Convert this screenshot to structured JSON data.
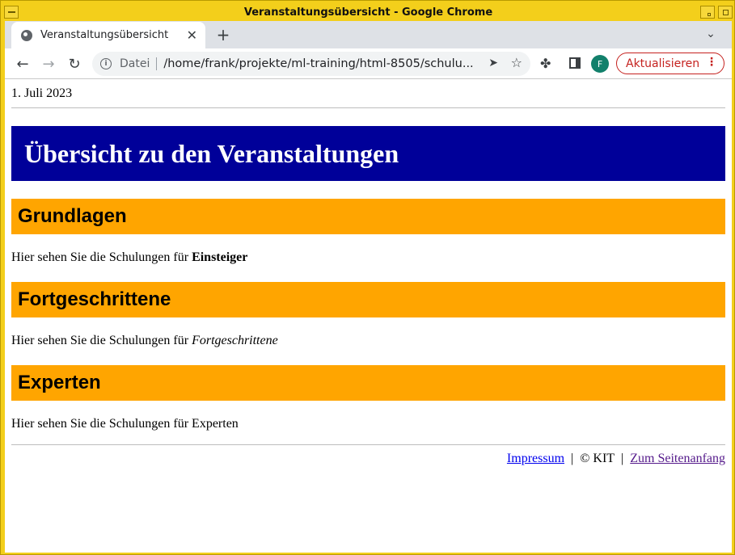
{
  "window": {
    "title": "Veranstaltungsübersicht - Google Chrome"
  },
  "browser": {
    "tab_title": "Veranstaltungsübersicht",
    "tab_close": "✕",
    "new_tab": "+",
    "tab_list": "⌄",
    "back": "←",
    "forward": "→",
    "reload": "↻",
    "scheme_label": "Datei",
    "url": "/home/frank/projekte/ml-training/html-8505/schulu...",
    "send_icon": "➤",
    "star_icon": "☆",
    "extensions_icon": "✤",
    "profile_initial": "F",
    "update_label": "Aktualisieren",
    "menu_dots": "⋮",
    "accent": "#c5221f",
    "profile_color": "#12806b"
  },
  "page": {
    "date": "1. Juli 2023",
    "banner_title": "Übersicht zu den Veranstaltungen",
    "banner_color": "#000099",
    "section_color": "#ffa500",
    "sections": [
      {
        "heading": "Grundlagen",
        "text_prefix": "Hier sehen Sie die Schulungen für ",
        "emphasis": "Einsteiger"
      },
      {
        "heading": "Fortgeschrittene",
        "text_prefix": "Hier sehen Sie die Schulungen für ",
        "emphasis": "Fortgeschrittene"
      },
      {
        "heading": "Experten",
        "text": "Hier sehen Sie die Schulungen für Experten"
      }
    ],
    "footer": {
      "impressum": "Impressum",
      "separator": "|",
      "copyright": "© KIT",
      "top_link": "Zum Seitenanfang"
    }
  }
}
